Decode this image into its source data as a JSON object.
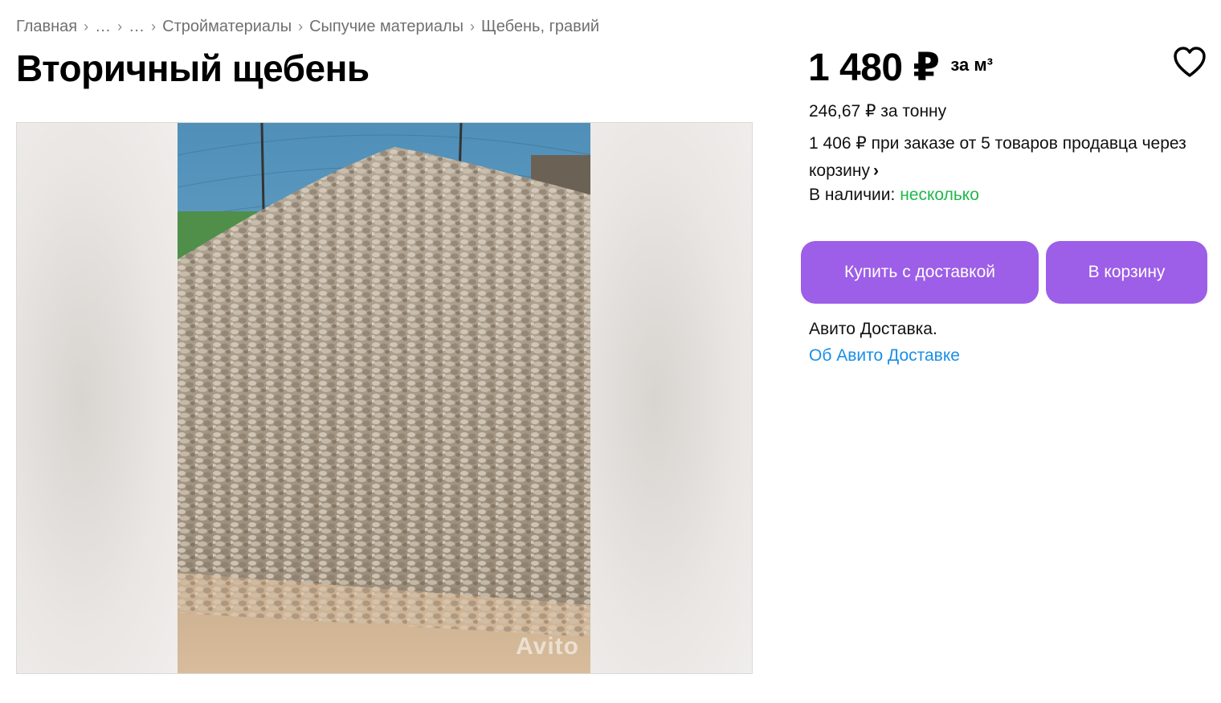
{
  "breadcrumb": {
    "items": [
      "Главная",
      "…",
      "…",
      "Стройматериалы",
      "Сыпучие материалы",
      "Щебень, гравий"
    ],
    "separator": "›"
  },
  "listing": {
    "title": "Вторичный щебень",
    "price": "1 480 ₽",
    "price_unit": "за м³",
    "price_per_ton": "246,67 ₽ за тонну",
    "bulk_offer": "1 406 ₽ при заказе от 5 товаров продавца через корзину",
    "bulk_chevron": "›",
    "stock_label": "В наличии:",
    "stock_value": "несколько",
    "image_watermark": "Avito"
  },
  "actions": {
    "buy_with_delivery": "Купить с доставкой",
    "add_to_cart": "В корзину"
  },
  "delivery": {
    "label": "Авито Доставка.",
    "link": "Об Авито Доставке"
  },
  "icons": {
    "favorite": "heart-icon",
    "bulk_chevron": "chevron-right-icon"
  },
  "colors": {
    "accent_button": "#9d5ee8",
    "stock_green": "#1fb84a",
    "link_blue": "#1a8fe6"
  }
}
